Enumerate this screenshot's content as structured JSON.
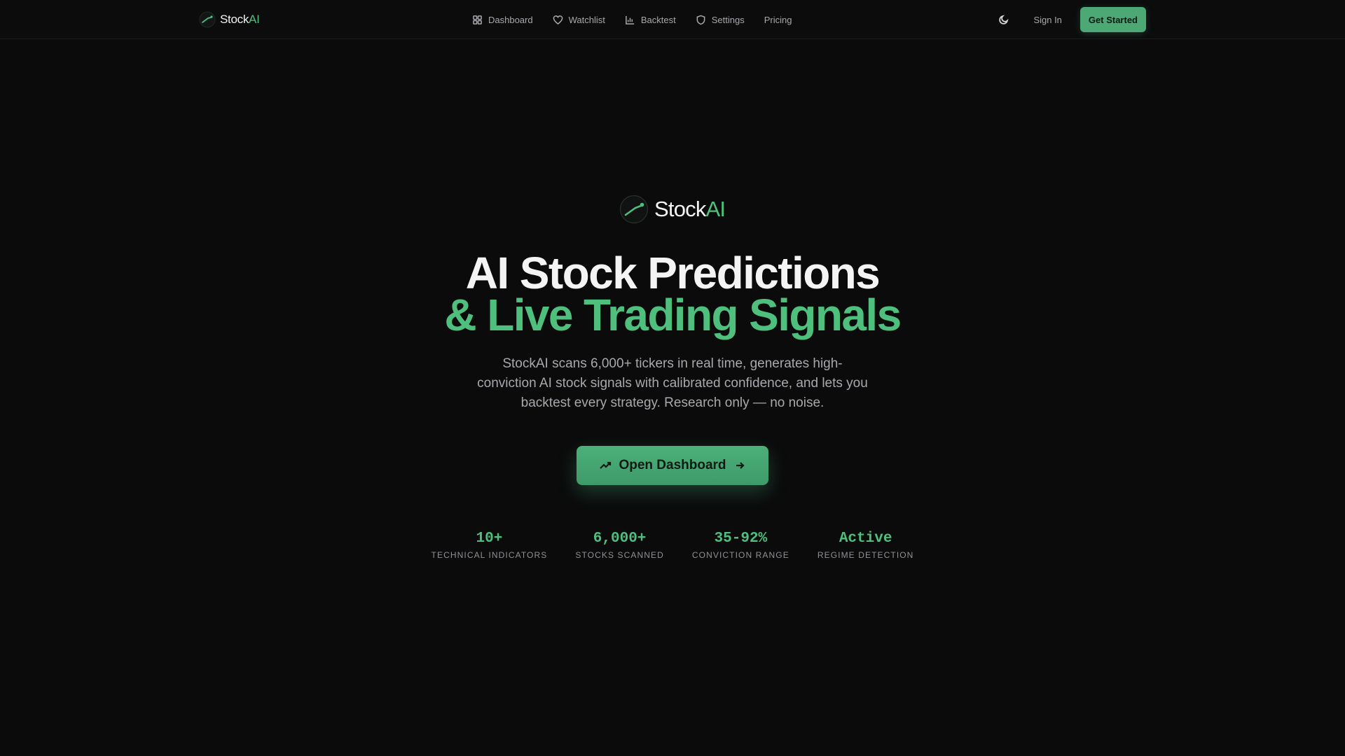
{
  "brand": {
    "name": "Stock",
    "name_ai": "AI"
  },
  "nav": {
    "items": [
      {
        "label": "Dashboard",
        "icon": "dashboard-icon"
      },
      {
        "label": "Watchlist",
        "icon": "heart-icon"
      },
      {
        "label": "Backtest",
        "icon": "bar-chart-icon"
      },
      {
        "label": "Settings",
        "icon": "shield-icon"
      },
      {
        "label": "Pricing",
        "icon": ""
      }
    ]
  },
  "actions": {
    "theme_icon": "moon-icon",
    "signin": "Sign In",
    "get_started": "Get Started"
  },
  "hero": {
    "logo": {
      "name": "Stock",
      "name_ai": "AI"
    },
    "headline_line1": "AI Stock Predictions",
    "headline_line2": "& Live Trading Signals",
    "subtitle": "StockAI scans 6,000+ tickers in real time, generates high-conviction AI stock signals with calibrated confidence, and lets you backtest every strategy. Research only — no noise.",
    "cta": {
      "label": "Open Dashboard",
      "left_icon": "trending-up-icon",
      "right_icon": "arrow-right-icon"
    }
  },
  "stats": [
    {
      "value": "10+",
      "label": "TECHNICAL INDICATORS"
    },
    {
      "value": "6,000+",
      "label": "STOCKS SCANNED"
    },
    {
      "value": "35-92%",
      "label": "CONVICTION RANGE"
    },
    {
      "value": "Active",
      "label": "REGIME DETECTION"
    }
  ],
  "colors": {
    "background": "#0b0b0c",
    "accent": "#4fbf7e",
    "text": "#f4f4f5",
    "muted": "#a7a9ad"
  }
}
